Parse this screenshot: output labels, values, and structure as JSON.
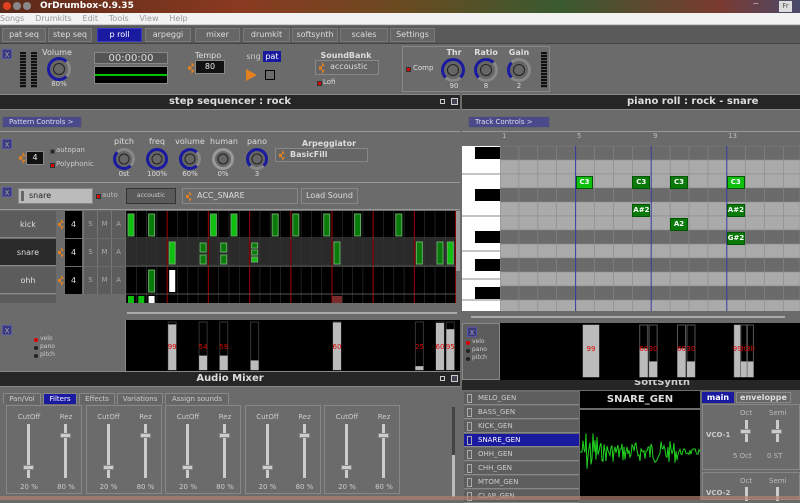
{
  "window": {
    "title": "OrDrumbox-0.9.35",
    "tray_lang": "Fr"
  },
  "menu": [
    "Songs",
    "Drumkits",
    "Edit",
    "Tools",
    "View",
    "Help"
  ],
  "tabs": [
    {
      "label": "pat seq",
      "active": false
    },
    {
      "label": "step seq",
      "active": false
    },
    {
      "label": "p roll",
      "active": true
    },
    {
      "label": "arpeggi",
      "active": false
    },
    {
      "label": "mixer",
      "active": false
    },
    {
      "label": "drumkit",
      "active": false
    },
    {
      "label": "softsynth",
      "active": false
    },
    {
      "label": "scales",
      "active": false
    },
    {
      "label": "Settings",
      "active": false
    }
  ],
  "transport": {
    "close_label": "X",
    "volume_label": "Volume",
    "volume_value": "80%",
    "volume_fraction": 0.8,
    "time": "00:00:00",
    "tempo_label": "Tempo",
    "tempo_value": "80",
    "mode_song": "sng",
    "mode_pattern": "pat",
    "soundbank_label": "SoundBank",
    "soundbank_value": "accoustic",
    "lofi_label": "Lofi",
    "comp_label": "Comp",
    "thr_label": "Thr",
    "thr_value": "90",
    "ratio_label": "Ratio",
    "ratio_value": "8",
    "gain_label": "Gain",
    "gain_value": "2",
    "colors": {
      "accent": "#1a1aa0",
      "play": "#e08020",
      "meter_green": "#00c000"
    }
  },
  "step_seq": {
    "title": "step sequencer : rock",
    "pattern_controls": "Pattern Controls >",
    "close_label": "X",
    "steps_value": "4",
    "autopan_label": "autopan",
    "polyphonic_label": "Polyphonic",
    "knobs": [
      {
        "label": "pitch",
        "value": "0st",
        "fraction": 0.5
      },
      {
        "label": "freq",
        "value": "100%",
        "fraction": 1.0
      },
      {
        "label": "volume",
        "value": "60%",
        "fraction": 0.6
      },
      {
        "label": "human",
        "value": "0%",
        "fraction": 0.0
      },
      {
        "label": "pano",
        "value": "3",
        "fraction": 0.55
      }
    ],
    "arpeggiator_label": "Arpeggiator",
    "arpeggiator_value": "BasicFill",
    "track_name": "snare",
    "auto_label": "auto",
    "bank_label": "accoustic",
    "sound_value": "ACC_SNARE",
    "load_sound": "Load Sound",
    "tracks": [
      {
        "name": "kick",
        "steps": "4",
        "s": "S",
        "m": "M",
        "a": "A"
      },
      {
        "name": "snare",
        "steps": "4",
        "s": "S",
        "m": "M",
        "a": "A"
      },
      {
        "name": "ohh",
        "steps": "4",
        "s": "S",
        "m": "M",
        "a": "A"
      }
    ],
    "velocity_legend": [
      "velo",
      "pano",
      "pitch"
    ],
    "velocity_labels": [
      "99",
      "54",
      "59",
      "",
      "60",
      "25",
      "60",
      "95"
    ]
  },
  "piano_roll": {
    "title": "piano roll : rock - snare",
    "track_controls": "Track Controls >",
    "bar_numbers": [
      "1",
      "5",
      "9",
      "13"
    ],
    "notes": [
      {
        "label": "C3",
        "step": 5
      },
      {
        "label": "C3",
        "step": 8
      },
      {
        "label": "C3",
        "step": 10
      },
      {
        "label": "C3",
        "step": 13
      },
      {
        "label": "A#2",
        "step": 8
      },
      {
        "label": "A#2",
        "step": 13
      },
      {
        "label": "A2",
        "step": 10
      },
      {
        "label": "G#2",
        "step": 13
      }
    ],
    "velocity_legend": [
      "velo",
      "pano",
      "pitch"
    ],
    "velocity_labels": [
      "99",
      "60",
      "30",
      "60",
      "30",
      "99",
      "30",
      "30"
    ]
  },
  "mixer": {
    "title": "Audio Mixer",
    "tabs": [
      "Pan/Vol",
      "Filters",
      "Effects",
      "Variations",
      "Assign sounds"
    ],
    "active_tab": "Filters",
    "channels": [
      {
        "cutoff_label": "CutOff",
        "cutoff": "20 %",
        "rez_label": "Rez",
        "rez": "80 %"
      },
      {
        "cutoff_label": "CutOff",
        "cutoff": "20 %",
        "rez_label": "Rez",
        "rez": "80 %"
      },
      {
        "cutoff_label": "CutOff",
        "cutoff": "20 %",
        "rez_label": "Rez",
        "rez": "80 %"
      },
      {
        "cutoff_label": "CutOff",
        "cutoff": "20 %",
        "rez_label": "Rez",
        "rez": "80 %"
      },
      {
        "cutoff_label": "CutOff",
        "cutoff": "20 %",
        "rez_label": "Rez",
        "rez": "80 %"
      }
    ]
  },
  "softsynth": {
    "title": "SoftSynth",
    "generators": [
      "MELO_GEN",
      "BASS_GEN",
      "KICK_GEN",
      "SNARE_GEN",
      "OHH_GEN",
      "CHH_GEN",
      "MTOM_GEN",
      "CLAP_GEN"
    ],
    "selected": "SNARE_GEN",
    "display_title": "SNARE_GEN",
    "tabs": [
      "main",
      "enveloppe"
    ],
    "vco1_label": "VCO-1",
    "vco2_label": "VCO-2",
    "oct_label": "Oct",
    "semi_label": "Semi",
    "oct_value": "5 Oct",
    "semi_value": "0 ST"
  }
}
